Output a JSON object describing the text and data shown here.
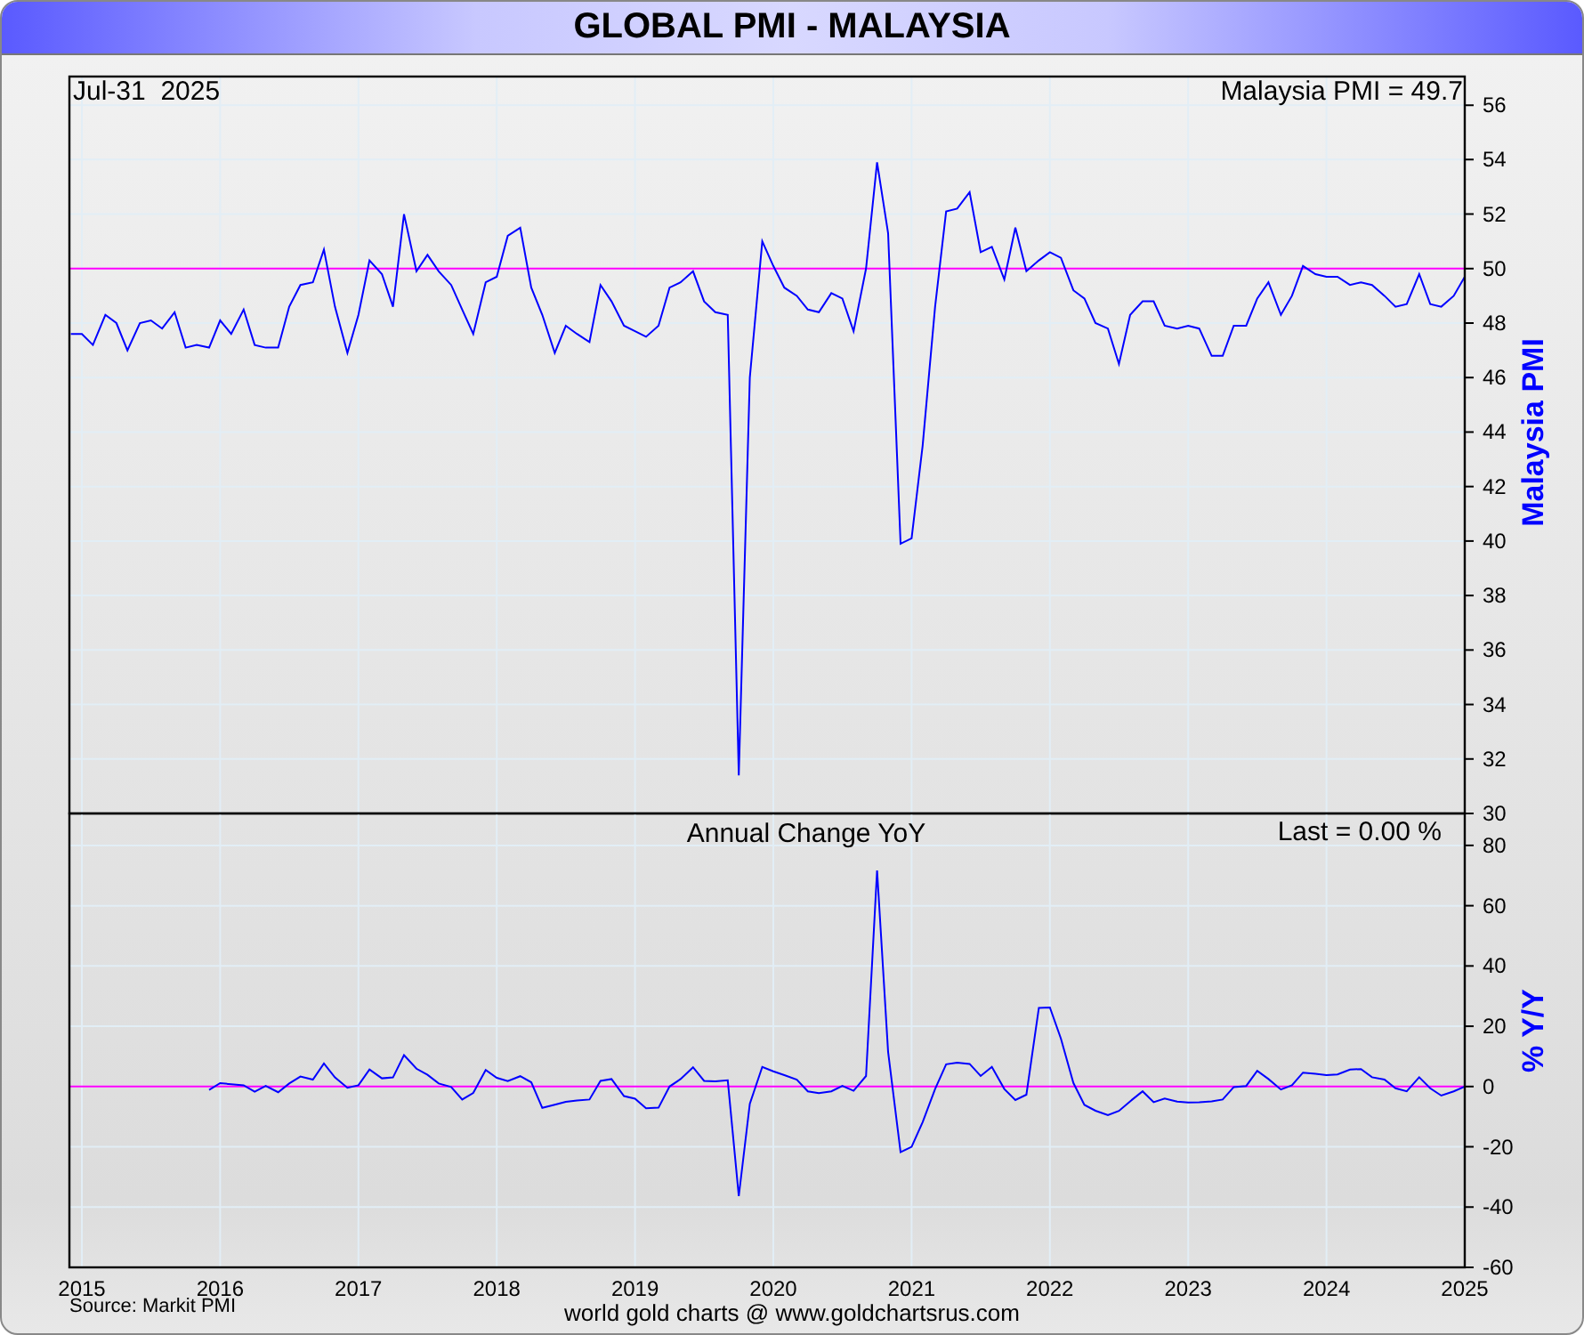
{
  "window": {
    "title": "GLOBAL PMI - MALAYSIA"
  },
  "upper_panel": {
    "date": "Jul-31  2025",
    "reading": "Malaysia PMI = 49.7",
    "chart_data": {
      "type": "line",
      "ylabel": "Malaysia PMI",
      "xlim": [
        2014.91,
        2025
      ],
      "ylim": [
        30,
        57.05
      ],
      "grid": true,
      "yticks": [
        30,
        32,
        34,
        36,
        38,
        40,
        42,
        44,
        46,
        48,
        50,
        52,
        54,
        56
      ],
      "ref_lines": [
        {
          "axis": "y",
          "value": 50
        }
      ],
      "x": [
        2014.92,
        2015,
        2015.08,
        2015.17,
        2015.25,
        2015.33,
        2015.42,
        2015.5,
        2015.58,
        2015.67,
        2015.75,
        2015.83,
        2015.92,
        2016,
        2016.08,
        2016.17,
        2016.25,
        2016.33,
        2016.42,
        2016.5,
        2016.58,
        2016.67,
        2016.75,
        2016.83,
        2016.92,
        2017,
        2017.08,
        2017.17,
        2017.25,
        2017.33,
        2017.42,
        2017.5,
        2017.58,
        2017.67,
        2017.75,
        2017.83,
        2017.92,
        2018,
        2018.08,
        2018.17,
        2018.25,
        2018.33,
        2018.42,
        2018.5,
        2018.58,
        2018.67,
        2018.75,
        2018.83,
        2018.92,
        2019,
        2019.08,
        2019.17,
        2019.25,
        2019.33,
        2019.42,
        2019.5,
        2019.58,
        2019.67,
        2019.75,
        2019.83,
        2019.92,
        2020,
        2020.08,
        2020.17,
        2020.25,
        2020.33,
        2020.42,
        2020.5,
        2020.58,
        2020.67,
        2020.75,
        2020.83,
        2020.92,
        2021,
        2021.08,
        2021.17,
        2021.25,
        2021.33,
        2021.42,
        2021.5,
        2021.58,
        2021.67,
        2021.75,
        2021.83,
        2021.92,
        2022,
        2022.08,
        2022.17,
        2022.25,
        2022.33,
        2022.42,
        2022.5,
        2022.58,
        2022.67,
        2022.75,
        2022.83,
        2022.92,
        2023,
        2023.08,
        2023.17,
        2023.25,
        2023.33,
        2023.42,
        2023.5,
        2023.58,
        2023.67,
        2023.75,
        2023.83,
        2023.92,
        2024,
        2024.08,
        2024.17,
        2024.25,
        2024.33,
        2024.42,
        2024.5,
        2024.58,
        2024.67,
        2024.75,
        2024.83,
        2024.92,
        2025
      ],
      "series": [
        {
          "color": "#0000ff",
          "values": [
            47.6,
            47.6,
            47.2,
            48.3,
            48.0,
            47.0,
            48.0,
            48.1,
            47.8,
            48.4,
            47.1,
            47.2,
            47.1,
            48.1,
            47.6,
            48.5,
            47.2,
            47.1,
            47.1,
            48.6,
            49.4,
            49.5,
            50.7,
            48.6,
            46.9,
            48.3,
            50.3,
            49.8,
            48.6,
            52.0,
            49.9,
            50.5,
            49.9,
            49.4,
            48.5,
            47.6,
            49.5,
            49.7,
            51.2,
            51.5,
            49.3,
            48.3,
            46.9,
            47.9,
            47.6,
            47.3,
            49.4,
            48.8,
            47.9,
            47.7,
            47.5,
            47.9,
            49.3,
            49.5,
            49.9,
            48.8,
            48.4,
            48.3,
            31.4,
            46.0,
            51.0,
            50.1,
            49.3,
            49.0,
            48.5,
            48.4,
            49.1,
            48.9,
            47.7,
            50.0,
            53.9,
            51.3,
            39.9,
            40.1,
            43.5,
            48.6,
            52.1,
            52.2,
            52.8,
            50.6,
            50.8,
            49.6,
            51.5,
            49.9,
            50.3,
            50.6,
            50.4,
            49.2,
            48.9,
            48.0,
            47.8,
            46.5,
            48.3,
            48.8,
            48.8,
            47.9,
            47.8,
            47.9,
            47.8,
            46.8,
            46.8,
            47.9,
            47.9,
            48.9,
            49.5,
            48.3,
            49.0,
            50.1,
            49.8,
            49.7,
            49.7,
            49.4,
            49.5,
            49.4,
            49.0,
            48.6,
            48.7,
            49.8,
            48.7,
            48.6,
            49.0,
            49.7
          ]
        }
      ]
    }
  },
  "lower_panel": {
    "reading": "Last = 0.00 %",
    "chart_data": {
      "type": "line",
      "title": "Annual Change YoY",
      "ylabel": "% Y/Y",
      "xlim": [
        2014.91,
        2025
      ],
      "ylim": [
        -60,
        90.6
      ],
      "grid": true,
      "xticks": [
        2015,
        2016,
        2017,
        2018,
        2019,
        2020,
        2021,
        2022,
        2023,
        2024,
        2025
      ],
      "yticks": [
        -60,
        -40,
        -20,
        0,
        20,
        40,
        60,
        80
      ],
      "ref_lines": [
        {
          "axis": "y",
          "value": 0
        }
      ],
      "x": [
        2015.92,
        2016,
        2016.08,
        2016.17,
        2016.25,
        2016.33,
        2016.42,
        2016.5,
        2016.58,
        2016.67,
        2016.75,
        2016.83,
        2016.92,
        2017,
        2017.08,
        2017.17,
        2017.25,
        2017.33,
        2017.42,
        2017.5,
        2017.58,
        2017.67,
        2017.75,
        2017.83,
        2017.92,
        2018,
        2018.08,
        2018.17,
        2018.25,
        2018.33,
        2018.42,
        2018.5,
        2018.58,
        2018.67,
        2018.75,
        2018.83,
        2018.92,
        2019,
        2019.08,
        2019.17,
        2019.25,
        2019.33,
        2019.42,
        2019.5,
        2019.58,
        2019.67,
        2019.75,
        2019.83,
        2019.92,
        2020,
        2020.08,
        2020.17,
        2020.25,
        2020.33,
        2020.42,
        2020.5,
        2020.58,
        2020.67,
        2020.75,
        2020.83,
        2020.92,
        2021,
        2021.08,
        2021.17,
        2021.25,
        2021.33,
        2021.42,
        2021.5,
        2021.58,
        2021.67,
        2021.75,
        2021.83,
        2021.92,
        2022,
        2022.08,
        2022.17,
        2022.25,
        2022.33,
        2022.42,
        2022.5,
        2022.58,
        2022.67,
        2022.75,
        2022.83,
        2022.92,
        2023,
        2023.08,
        2023.17,
        2023.25,
        2023.33,
        2023.42,
        2023.5,
        2023.58,
        2023.67,
        2023.75,
        2023.83,
        2023.92,
        2024,
        2024.08,
        2024.17,
        2024.25,
        2024.33,
        2024.42,
        2024.5,
        2024.58,
        2024.67,
        2024.75,
        2024.83,
        2024.92,
        2025
      ],
      "series": [
        {
          "color": "#0000ff",
          "values": [
            -1.1,
            1.1,
            0.8,
            0.4,
            -1.7,
            0.2,
            -1.9,
            1.0,
            3.3,
            2.3,
            7.6,
            3.0,
            -0.4,
            0.4,
            5.7,
            2.7,
            3.0,
            10.4,
            5.9,
            3.9,
            1.0,
            -0.2,
            -4.3,
            -2.1,
            5.5,
            2.9,
            1.8,
            3.4,
            1.4,
            -7.1,
            -6.0,
            -5.1,
            -4.6,
            -4.3,
            1.9,
            2.5,
            -3.2,
            -4.0,
            -7.2,
            -7.0,
            0,
            2.5,
            6.4,
            1.9,
            1.7,
            2.1,
            -36.4,
            -5.7,
            6.5,
            5.0,
            3.8,
            2.3,
            -1.6,
            -2.2,
            -1.6,
            0.2,
            -1.4,
            3.5,
            71.7,
            11.5,
            -21.8,
            -20.0,
            -11.8,
            -0.8,
            7.4,
            7.9,
            7.5,
            3.5,
            6.5,
            -0.8,
            -4.5,
            -2.7,
            26.1,
            26.2,
            15.9,
            1.2,
            -6.1,
            -8.0,
            -9.5,
            -8.1,
            -4.9,
            -1.6,
            -5.2,
            -4.0,
            -5.0,
            -5.3,
            -5.2,
            -4.9,
            -4.3,
            -0.2,
            0.2,
            5.2,
            2.5,
            -1.0,
            0.4,
            4.6,
            4.2,
            3.8,
            4.0,
            5.6,
            5.8,
            3.1,
            2.3,
            -0.6,
            -1.6,
            3.1,
            -0.6,
            -3.0,
            -1.6,
            0.0
          ]
        }
      ]
    }
  },
  "footer": {
    "source": "Source: Markit PMI",
    "credit": "world gold charts @ www.goldchartsrus.com"
  }
}
